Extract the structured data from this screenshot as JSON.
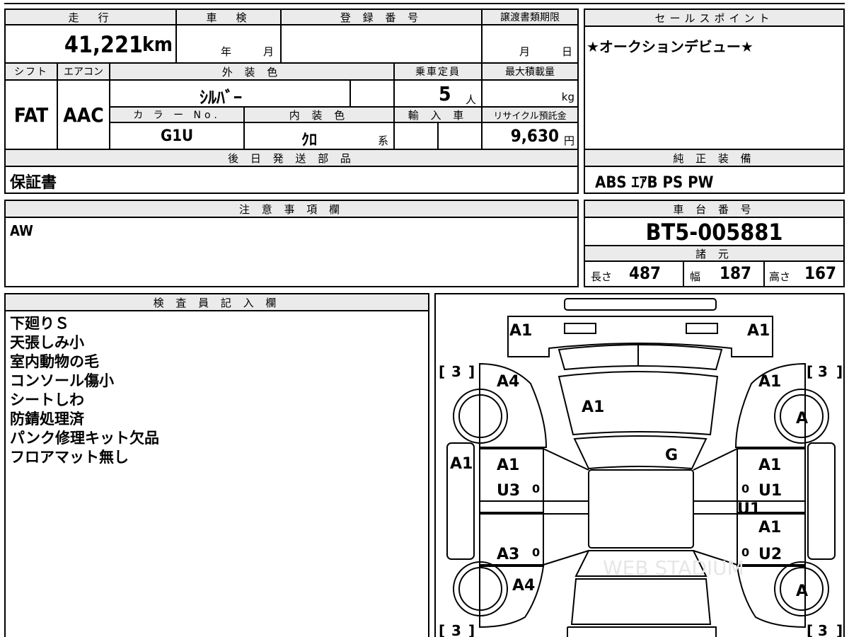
{
  "top": {
    "mileage_header": "走　行",
    "mileage_value": "41,221",
    "mileage_unit": "km",
    "inspection_header": "車　検",
    "inspection_year": "年",
    "inspection_month": "月",
    "registration_header": "登 録 番 号",
    "registration_value": "",
    "transfer_header": "譲渡書類期限",
    "transfer_month": "月",
    "transfer_day": "日",
    "shift_header": "シフト",
    "shift_value": "FAT",
    "ac_header": "エアコン",
    "ac_value": "AAC",
    "exterior_header": "外 装 色",
    "exterior_value": "ｼﾙﾊﾞｰ",
    "capacity_header": "乗車定員",
    "capacity_value": "5",
    "capacity_unit": "人",
    "maxload_header": "最大積載量",
    "maxload_unit": "kg",
    "color_no_header": "カ ラ ー No.",
    "color_no_value": "G1U",
    "interior_header": "内 装 色",
    "interior_value": "ｸﾛ",
    "interior_unit": "系",
    "import_header": "輸 入 車",
    "recycle_header": "リサイクル預託金",
    "recycle_value": "9,630",
    "recycle_unit": "円"
  },
  "sales": {
    "header": "セールスポイント",
    "text": "★オークションデビュー★"
  },
  "later_parts": {
    "header": "後 日 発 送 部 品",
    "text": "保証書"
  },
  "equipment": {
    "header": "純 正 装 備",
    "text": "ABS ｴｱB PS PW"
  },
  "notes": {
    "header": "注 意 事 項 欄",
    "text": "AW"
  },
  "chassis": {
    "header": "車 台 番 号",
    "value": "BT5-005881",
    "specs_header": "諸 元",
    "length_label": "長さ",
    "length_value": "487",
    "width_label": "幅",
    "width_value": "187",
    "height_label": "高さ",
    "height_value": "167"
  },
  "inspector": {
    "header": "検 査 員 記 入 欄",
    "lines": [
      "下廻りＳ",
      "天張しみ小",
      "室内動物の毛",
      "コンソール傷小",
      "シートしわ",
      "防錆処理済",
      "パンク修理キット欠品",
      "フロアマット無し"
    ]
  },
  "diagram": {
    "watermark": "WEB STADIUM",
    "marks": {
      "hl_left": "A1",
      "hl_right": "A1",
      "fender_fl": "A4",
      "fender_fr": "A1",
      "hood": "A1",
      "windshield": "G",
      "side_l": "A1",
      "door_fl_1": "A1",
      "door_fl_2": "U3",
      "door_fr_1": "A1",
      "door_fr_2": "U1",
      "door_fr_3": "U1",
      "door_rr_1": "A1",
      "door_rr_2": "U2",
      "door_rl": "A3",
      "fender_rl": "A4",
      "tire_fr": "A",
      "tire_rr": "A",
      "tread_fl": "3",
      "tread_fr": "3",
      "tread_rl": "3",
      "tread_rr": "3",
      "gauge_fl": "0",
      "gauge_rl": "0",
      "gauge_fr": "0",
      "gauge_rr": "0",
      "bracket_open": "[",
      "bracket_close": "]"
    }
  }
}
